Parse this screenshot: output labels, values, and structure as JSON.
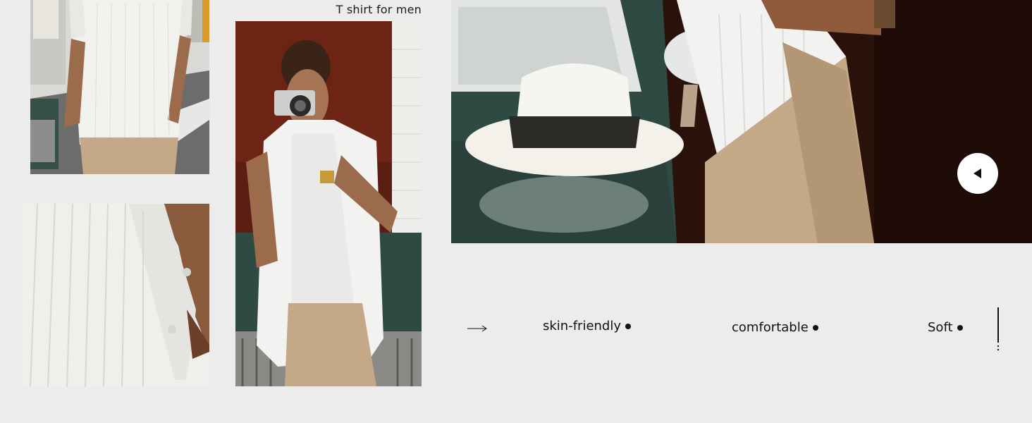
{
  "caption": "T shirt for men",
  "features": [
    {
      "label": "skin-friendly"
    },
    {
      "label": "comfortable"
    },
    {
      "label": "Soft"
    }
  ],
  "colors": {
    "background": "#ececec",
    "text": "#111111",
    "shirt": "#f2f2f0",
    "pants": "#c4a988",
    "car": "#2f4a42"
  },
  "icons": {
    "carousel_button": "triangle-left-icon",
    "arrow": "long-arrow-right-icon"
  }
}
